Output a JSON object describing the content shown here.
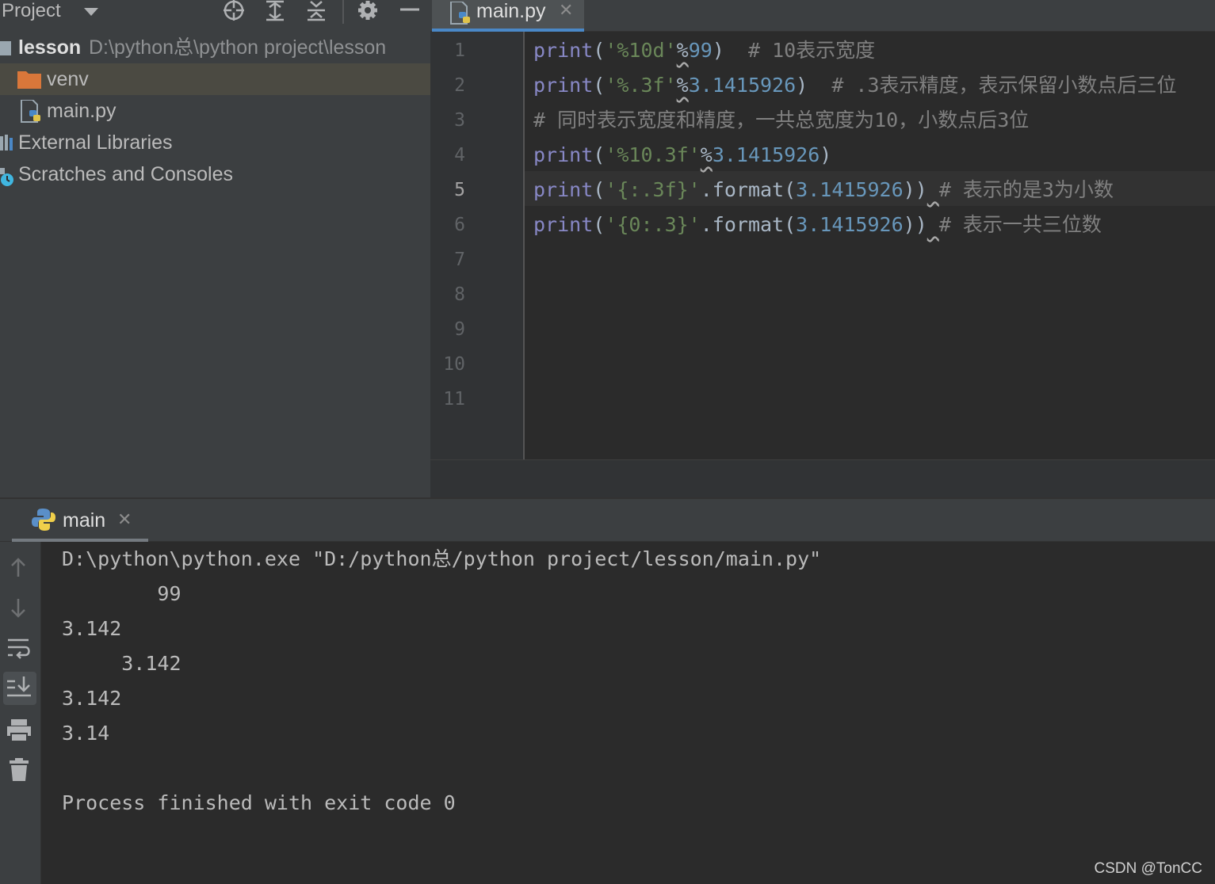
{
  "project_panel": {
    "title": "Project",
    "tree": [
      {
        "label": "lesson",
        "path": "D:\\python总\\python project\\lesson",
        "icon": "module-folder-icon"
      },
      {
        "label": "venv",
        "icon": "folder-icon",
        "selected": true
      },
      {
        "label": "main.py",
        "icon": "python-file-icon"
      },
      {
        "label": "External Libraries",
        "icon": "library-icon"
      },
      {
        "label": "Scratches and Consoles",
        "icon": "scratches-icon"
      }
    ]
  },
  "editor": {
    "tab_label": "main.py",
    "tab_close": "✕",
    "current_line": 5,
    "line_numbers": [
      "1",
      "2",
      "3",
      "4",
      "5",
      "6",
      "7",
      "8",
      "9",
      "10",
      "11"
    ],
    "lines": [
      [
        {
          "t": "print",
          "c": "fn"
        },
        {
          "t": "(",
          "c": "p"
        },
        {
          "t": "'%10d'",
          "c": "str"
        },
        {
          "t": "%",
          "c": "wavy"
        },
        {
          "t": "99",
          "c": "num"
        },
        {
          "t": ")  ",
          "c": "p"
        },
        {
          "t": "# 10表示宽度",
          "c": "cmt"
        }
      ],
      [
        {
          "t": "print",
          "c": "fn"
        },
        {
          "t": "(",
          "c": "p"
        },
        {
          "t": "'%.3f'",
          "c": "str"
        },
        {
          "t": "%",
          "c": "wavy"
        },
        {
          "t": "3.1415926",
          "c": "num"
        },
        {
          "t": ")  ",
          "c": "p"
        },
        {
          "t": "# .3表示精度，表示保留小数点后三位",
          "c": "cmt"
        }
      ],
      [
        {
          "t": "# 同时表示宽度和精度，一共总宽度为10，小数点后3位",
          "c": "cmt"
        }
      ],
      [
        {
          "t": "print",
          "c": "fn"
        },
        {
          "t": "(",
          "c": "p"
        },
        {
          "t": "'%10.3f'",
          "c": "str"
        },
        {
          "t": "%",
          "c": "wavy"
        },
        {
          "t": "3.1415926",
          "c": "num"
        },
        {
          "t": ")",
          "c": "p"
        }
      ],
      [
        {
          "t": "print",
          "c": "fn"
        },
        {
          "t": "(",
          "c": "p"
        },
        {
          "t": "'{:.3f}'",
          "c": "str"
        },
        {
          "t": ".format(",
          "c": "p"
        },
        {
          "t": "3.1415926",
          "c": "num"
        },
        {
          "t": "))",
          "c": "p"
        },
        {
          "t": " ",
          "c": "wavy"
        },
        {
          "t": "# 表示的是3为小数",
          "c": "cmt"
        }
      ],
      [
        {
          "t": "print",
          "c": "fn"
        },
        {
          "t": "(",
          "c": "p"
        },
        {
          "t": "'{0:.3}'",
          "c": "str"
        },
        {
          "t": ".format(",
          "c": "p"
        },
        {
          "t": "3.1415926",
          "c": "num"
        },
        {
          "t": "))",
          "c": "p"
        },
        {
          "t": " ",
          "c": "wavy"
        },
        {
          "t": "# 表示一共三位数",
          "c": "cmt"
        }
      ]
    ]
  },
  "run_panel": {
    "tab_label": "main",
    "tab_close": "✕",
    "toolbar": [
      "up-arrow-icon",
      "down-arrow-icon",
      "soft-wrap-icon",
      "scroll-to-end-icon",
      "print-icon",
      "trash-icon"
    ],
    "output": [
      "D:\\python\\python.exe \"D:/python总/python project/lesson/main.py\"",
      "        99",
      "3.142",
      "     3.142",
      "3.142",
      "3.14",
      "",
      "Process finished with exit code 0"
    ]
  },
  "watermark": "CSDN @TonCC",
  "colors": {
    "keyword_fn": "#8888c6",
    "string": "#6a8759",
    "number": "#6897bb",
    "comment": "#808080",
    "selection": "#4b4a42",
    "tab_accent": "#4a88c7"
  }
}
